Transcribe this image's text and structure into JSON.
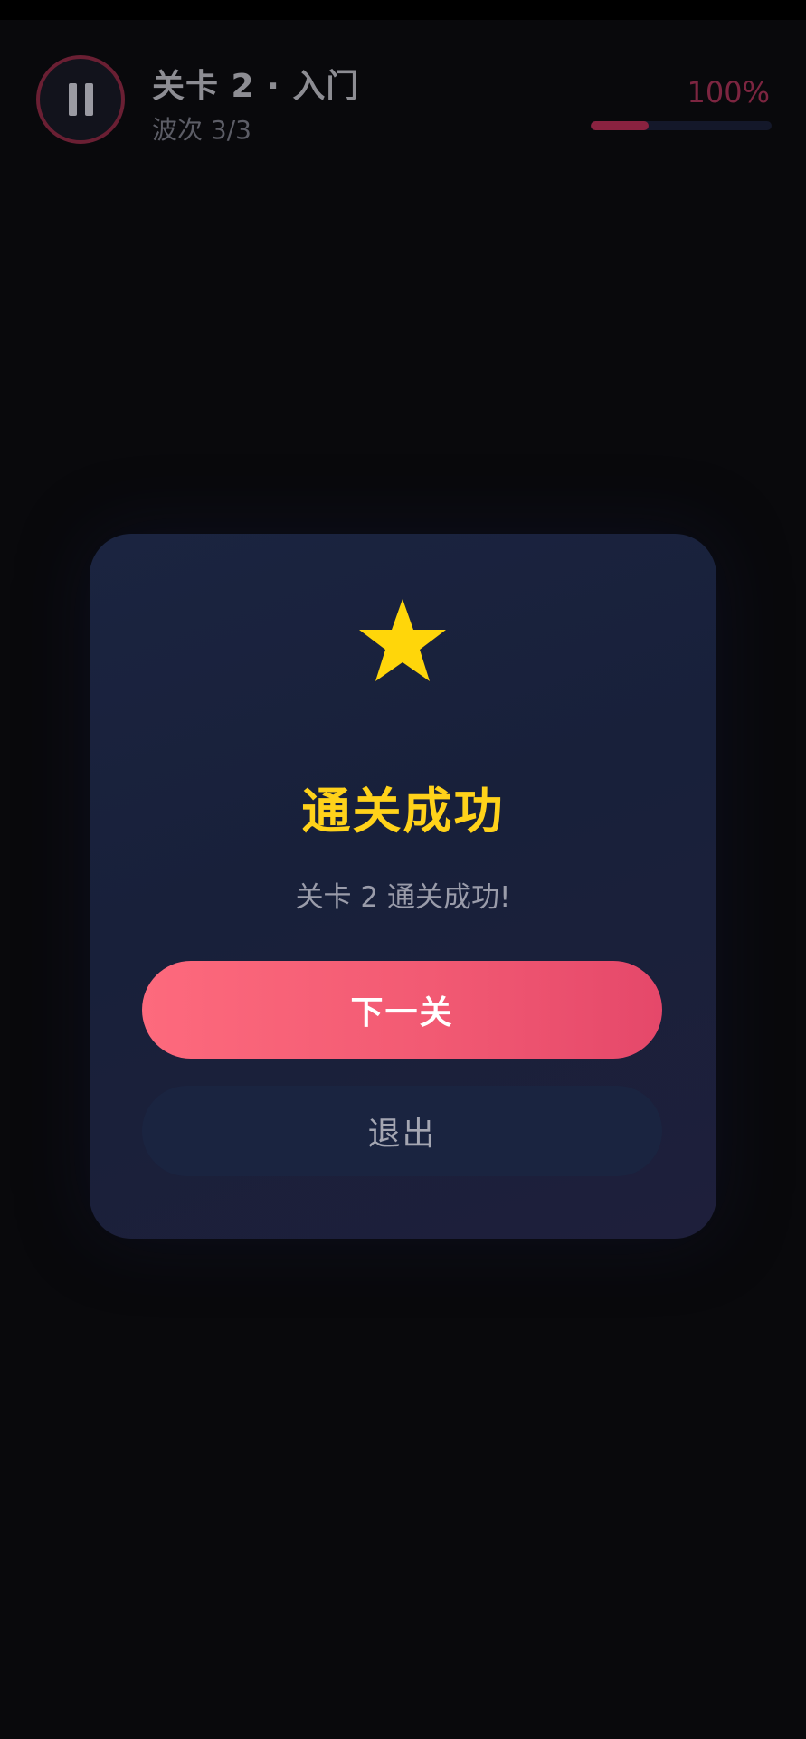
{
  "hud": {
    "level_title": "关卡 2 · 入门",
    "wave_label": "波次 3/3",
    "progress_percent": "100%",
    "pause_icon": "pause-icon"
  },
  "dialog": {
    "icon": "star-icon",
    "title": "通关成功",
    "message": "关卡 2 通关成功!",
    "next_label": "下一关",
    "exit_label": "退出"
  },
  "colors": {
    "accent": "#f25a73",
    "title_gold": "#ffd21a",
    "star": "#ffd60a",
    "background": "#09090c",
    "dialog_bg": "#1b2440"
  }
}
